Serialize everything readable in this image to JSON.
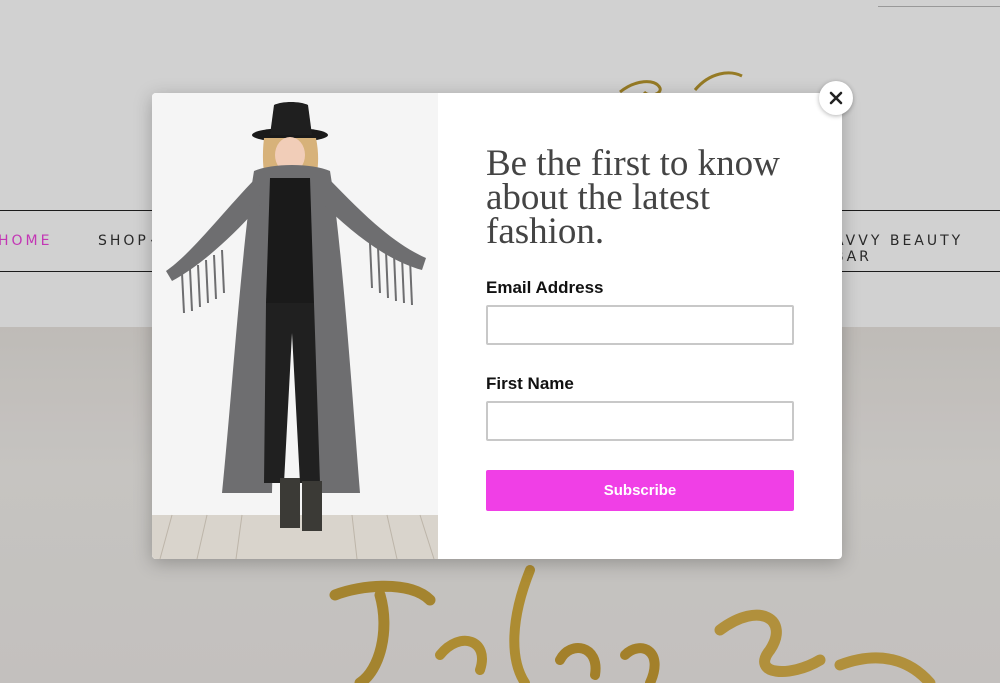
{
  "nav": {
    "items": [
      {
        "label": "HOME",
        "active": true
      },
      {
        "label": "SHOP",
        "has_dropdown": true
      },
      {
        "label": "AVVY BEAUTY BAR"
      }
    ],
    "active_color": "#ee44dd"
  },
  "popup": {
    "headline": "Be the first to know about the latest fashion.",
    "email_label": "Email Address",
    "email_value": "",
    "first_name_label": "First Name",
    "first_name_value": "",
    "subscribe_label": "Subscribe",
    "close_icon": "close-icon",
    "accent_color": "#f03fe6"
  }
}
